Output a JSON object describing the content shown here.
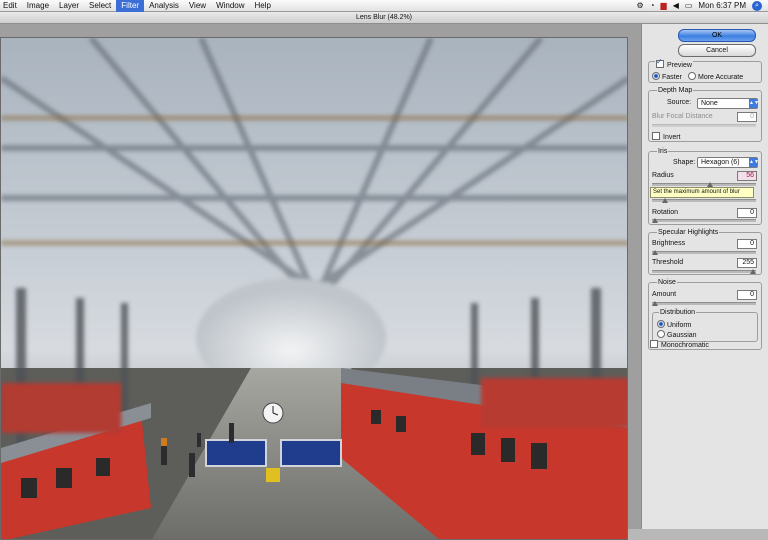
{
  "menubar": {
    "items": [
      "Edit",
      "Image",
      "Layer",
      "Select",
      "Filter",
      "Analysis",
      "View",
      "Window",
      "Help"
    ],
    "active_item": "Filter",
    "clock": "Mon 6:37 PM"
  },
  "dialog": {
    "title": "Lens Blur (48.2%)",
    "ok_label": "OK",
    "cancel_label": "Cancel",
    "preview_label": "Preview",
    "faster_label": "Faster",
    "more_accurate_label": "More Accurate",
    "depth_map": {
      "title": "Depth Map",
      "source_label": "Source:",
      "source_value": "None",
      "blur_focal_label": "Blur Focal Distance",
      "blur_focal_value": "0",
      "invert_label": "Invert"
    },
    "iris": {
      "title": "Iris",
      "shape_label": "Shape:",
      "shape_value": "Hexagon (6)",
      "radius_label": "Radius",
      "radius_value": "56",
      "radius_level": 0.56,
      "tooltip": "Set the maximum amount of blur",
      "curvature_level": 0.1,
      "rotation_label": "Rotation",
      "rotation_value": "0",
      "rotation_level": 0.0
    },
    "specular": {
      "title": "Specular Highlights",
      "brightness_label": "Brightness",
      "brightness_value": "0",
      "brightness_level": 0.0,
      "threshold_label": "Threshold",
      "threshold_value": "255",
      "threshold_level": 1.0
    },
    "noise": {
      "title": "Noise",
      "amount_label": "Amount",
      "amount_value": "0",
      "amount_level": 0.0,
      "distribution_title": "Distribution",
      "uniform_label": "Uniform",
      "gaussian_label": "Gaussian",
      "monochromatic_label": "Monochromatic"
    }
  },
  "colors": {
    "accent": "#3b6fd6",
    "train_red": "#c8372c"
  },
  "icons": [
    "script-icon",
    "wifi-icon",
    "flag-icon",
    "volume-icon",
    "battery-icon",
    "spotlight-icon"
  ]
}
